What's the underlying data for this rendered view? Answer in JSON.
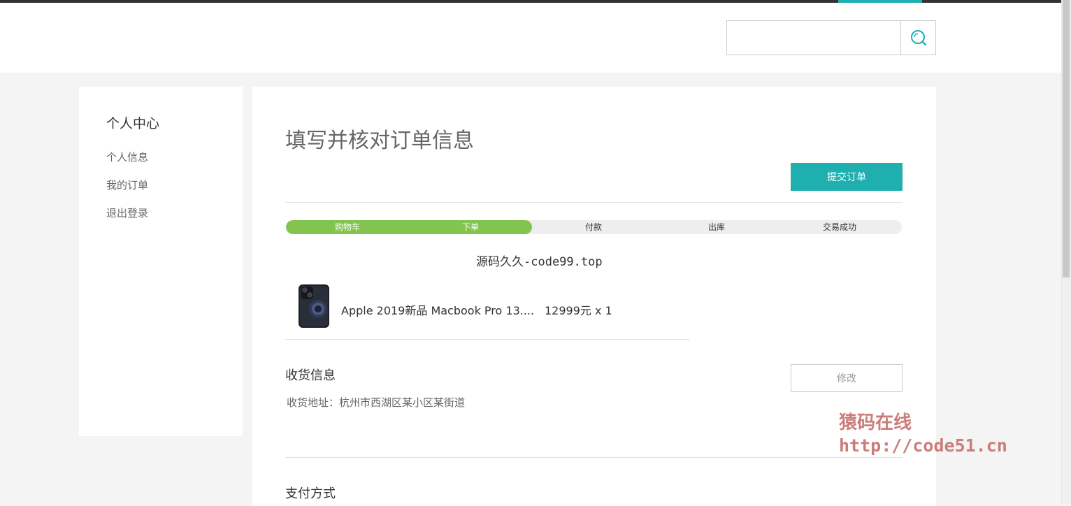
{
  "header": {
    "search": {
      "placeholder": "",
      "value": ""
    },
    "search_button_icon": "search-icon",
    "accent_color": "#1fafaf"
  },
  "sidebar": {
    "title": "个人中心",
    "items": [
      {
        "label": "个人信息"
      },
      {
        "label": "我的订单"
      },
      {
        "label": "退出登录"
      }
    ]
  },
  "main": {
    "title": "填写并核对订单信息",
    "submit_label": "提交订单",
    "progress": {
      "steps": [
        "购物车",
        "下单",
        "付款",
        "出库",
        "交易成功"
      ],
      "completed_steps": 2,
      "fill_color": "#83c44e"
    },
    "product_headline": "源码久久-code99.top",
    "items": [
      {
        "name": "Apple 2019新品 Macbook Pro 13....",
        "price": "12999元 x 1"
      }
    ],
    "shipping": {
      "title": "收货信息",
      "edit_label": "修改",
      "address": "收货地址：杭州市西湖区某小区某街道"
    },
    "payment": {
      "title": "支付方式"
    }
  },
  "watermark": {
    "line1": "猿码在线",
    "line2": "http://code51.cn"
  }
}
